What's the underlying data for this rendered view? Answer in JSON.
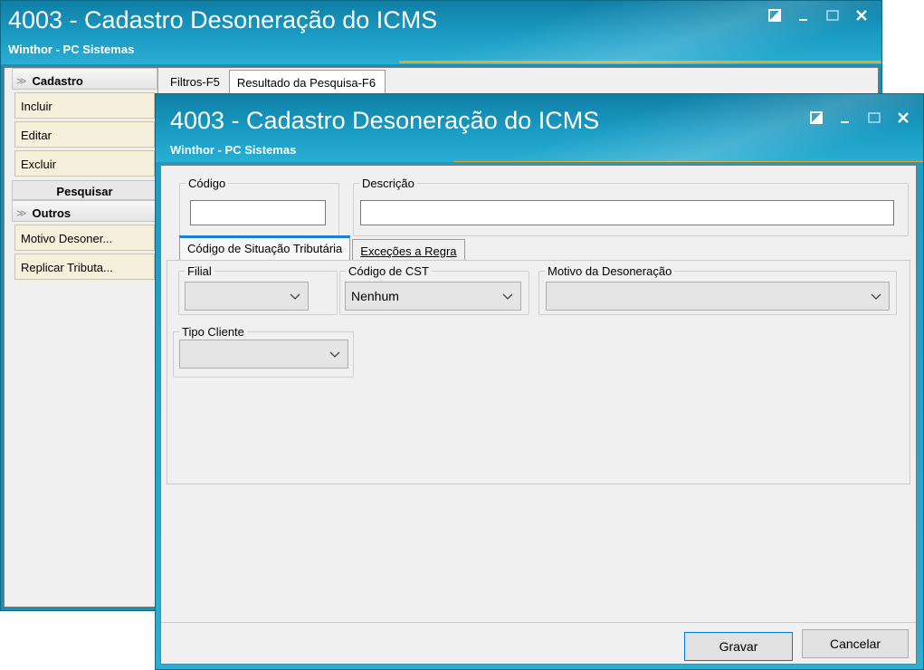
{
  "bg_window": {
    "title": "4003 - Cadastro Desoneração do ICMS",
    "subtitle": "Winthor - PC Sistemas",
    "sidebar": {
      "group1": "Cadastro",
      "buttons1": [
        "Incluir",
        "Editar",
        "Excluir"
      ],
      "group2": "Pesquisar",
      "group3": "Outros",
      "buttons3": [
        "Motivo Desoner...",
        "Replicar Tributa..."
      ]
    },
    "tabs": [
      "Filtros-F5",
      "Resultado da Pesquisa-F6"
    ]
  },
  "dialog": {
    "title": "4003 - Cadastro Desoneração do ICMS",
    "subtitle": "Winthor - PC Sistemas",
    "codigo_label": "Código",
    "codigo_value": "",
    "descricao_label": "Descrição",
    "descricao_value": "",
    "tabs": [
      "Código de Situação Tributária",
      "Exceções a Regra"
    ],
    "filial_label": "Filial",
    "filial_value": "",
    "cst_label": "Código de CST",
    "cst_value": "Nenhum",
    "motivo_label": "Motivo da Desoneração",
    "motivo_value": "",
    "tipo_cliente_label": "Tipo Cliente",
    "tipo_cliente_value": "",
    "gravar": "Gravar",
    "cancelar": "Cancelar"
  },
  "colors": {
    "title_blue": "#1a9cc4",
    "accent_gold": "#e0a82a",
    "side_button": "#f5f0dc",
    "tab_accent": "#1a7fd6"
  },
  "icons": [
    "restore-icon",
    "minimize-icon",
    "maximize-icon",
    "close-icon",
    "chevron-down-icon"
  ]
}
